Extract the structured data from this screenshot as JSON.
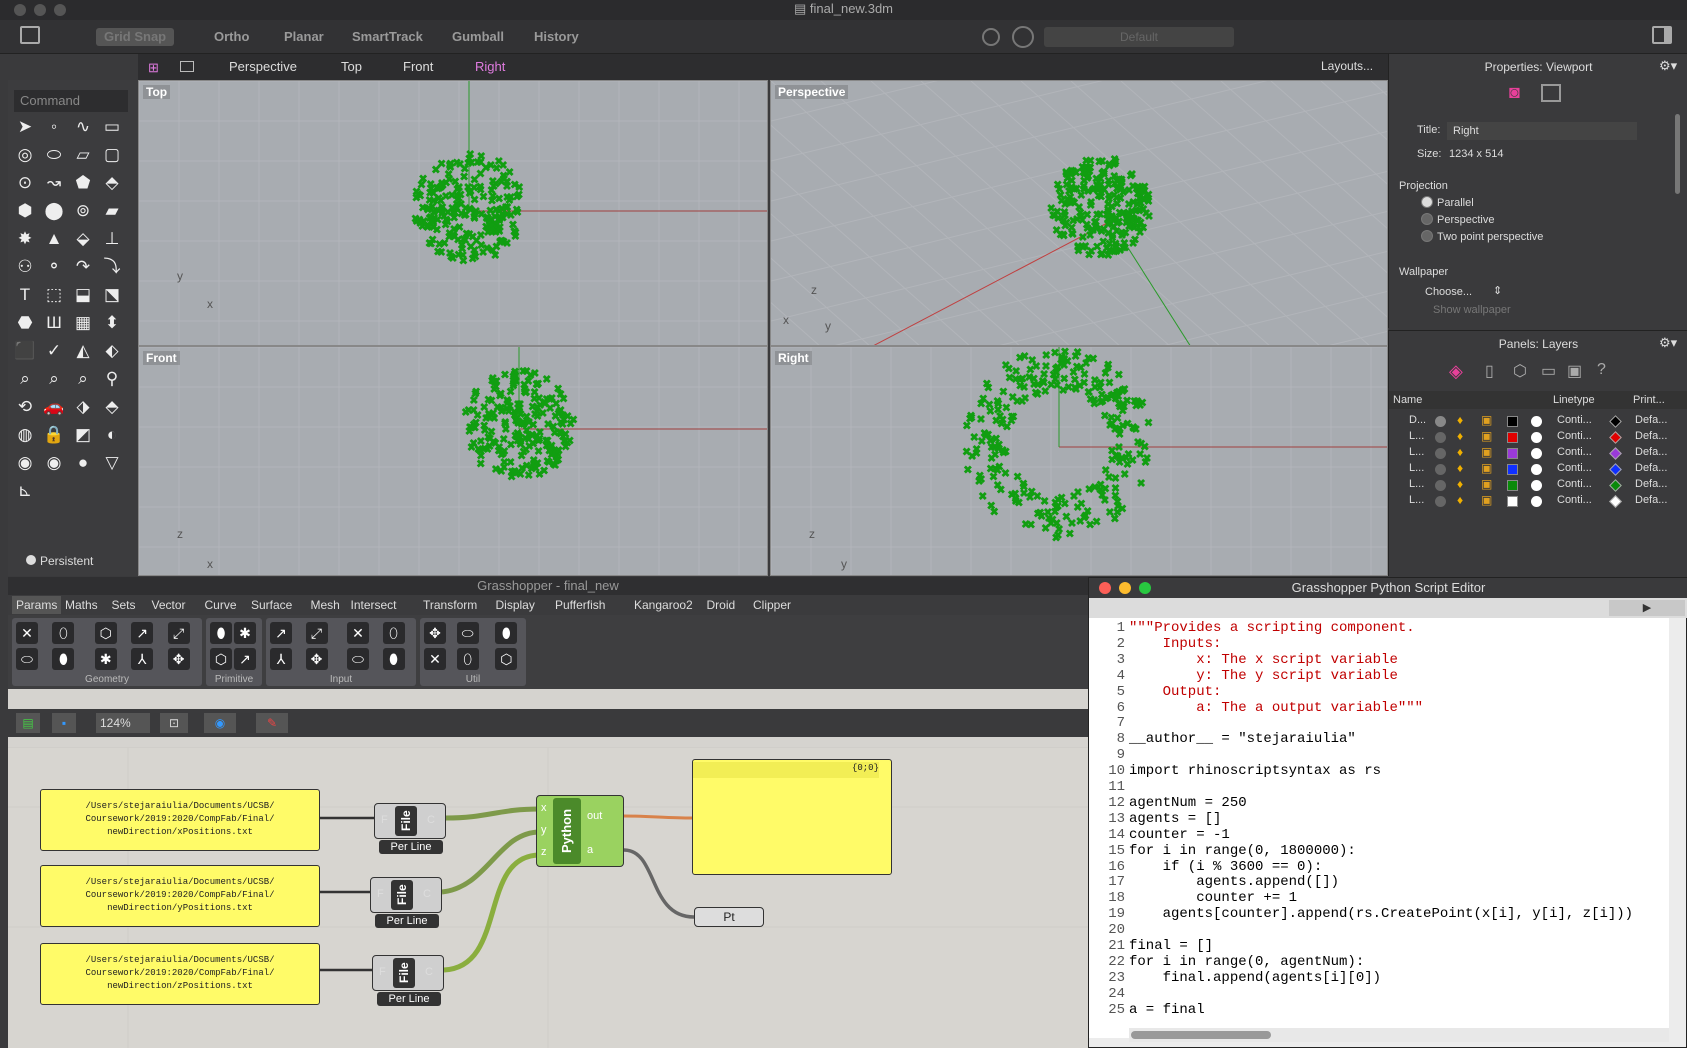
{
  "window": {
    "title": "final_new.3dm"
  },
  "main_toolbar": {
    "buttons": [
      "Grid Snap",
      "Ortho",
      "Planar",
      "SmartTrack",
      "Gumball",
      "History"
    ],
    "layer_box": "Default"
  },
  "viewport_tabs": {
    "tabs": [
      "Perspective",
      "Top",
      "Front",
      "Right"
    ],
    "active": "Right",
    "layouts": "Layouts..."
  },
  "command": {
    "placeholder": "Command",
    "osnap": "Persistent"
  },
  "viewports": {
    "top": {
      "label": "Top",
      "axis_a": "y",
      "axis_b": "x"
    },
    "perspective": {
      "label": "Perspective",
      "axis_a": "z",
      "axis_b": "x",
      "axis_c": "y"
    },
    "front": {
      "label": "Front",
      "axis_a": "z",
      "axis_b": "x"
    },
    "right": {
      "label": "Right",
      "axis_a": "z",
      "axis_b": "y"
    }
  },
  "properties": {
    "header": "Properties: Viewport",
    "title_label": "Title:",
    "title_value": "Right",
    "size_label": "Size:",
    "size_value": "1234 x 514",
    "projection_label": "Projection",
    "projection_options": [
      "Parallel",
      "Perspective",
      "Two point perspective"
    ],
    "projection_selected": "Parallel",
    "wallpaper_label": "Wallpaper",
    "wallpaper_choose": "Choose...",
    "show_wallpaper": "Show wallpaper"
  },
  "layers": {
    "header": "Panels: Layers",
    "columns": [
      "Name",
      "Linetype",
      "Print..."
    ],
    "rows": [
      {
        "name": "D...",
        "color": "#000000",
        "linetype": "Conti...",
        "print": "Defa..."
      },
      {
        "name": "L...",
        "color": "#e00000",
        "linetype": "Conti...",
        "print": "Defa..."
      },
      {
        "name": "L...",
        "color": "#9a3ad8",
        "linetype": "Conti...",
        "print": "Defa..."
      },
      {
        "name": "L...",
        "color": "#1030ff",
        "linetype": "Conti...",
        "print": "Defa..."
      },
      {
        "name": "L...",
        "color": "#0a8a0a",
        "linetype": "Conti...",
        "print": "Defa..."
      },
      {
        "name": "L...",
        "color": "#ffffff",
        "linetype": "Conti...",
        "print": "Defa..."
      }
    ]
  },
  "grasshopper": {
    "title": "Grasshopper - final_new",
    "tabs": [
      "Params",
      "Maths",
      "Sets",
      "Vector",
      "Curve",
      "Surface",
      "Mesh",
      "Intersect",
      "Transform",
      "Display",
      "Pufferfish",
      "Kangaroo2",
      "Droid",
      "Clipper"
    ],
    "palette_groups": [
      "Geometry",
      "Primitive",
      "Input",
      "Util"
    ],
    "zoom": "124%",
    "panels": [
      "/Users/stejaraiulia/Documents/UCSB/ Coursework/2019:2020/CompFab/Final/ newDirection/xPositions.txt",
      "/Users/stejaraiulia/Documents/UCSB/ Coursework/2019:2020/CompFab/Final/ newDirection/yPositions.txt",
      "/Users/stejaraiulia/Documents/UCSB/ Coursework/2019:2020/CompFab/Final/ newDirection/zPositions.txt"
    ],
    "file_component": {
      "left": "F",
      "name": "File",
      "right": "C",
      "label": "Per Line"
    },
    "python": {
      "name": "Python",
      "inputs": [
        "x",
        "y",
        "z"
      ],
      "outputs": [
        "out",
        "a"
      ]
    },
    "output_panel_header": "{0;0}",
    "pt_label": "Pt"
  },
  "editor": {
    "title": "Grasshopper Python Script Editor",
    "run": "▶",
    "lines": [
      "\"\"\"Provides a scripting component.",
      "    Inputs:",
      "        x: The x script variable",
      "        y: The y script variable",
      "    Output:",
      "        a: The a output variable\"\"\"",
      "",
      "__author__ = \"stejaraiulia\"",
      "",
      "import rhinoscriptsyntax as rs",
      "",
      "agentNum = 250",
      "agents = []",
      "counter = -1",
      "for i in range(0, 1800000):",
      "    if (i % 3600 == 0):",
      "        agents.append([])",
      "        counter += 1",
      "    agents[counter].append(rs.CreatePoint(x[i], y[i], z[i]))",
      "",
      "final = []",
      "for i in range(0, agentNum):",
      "    final.append(agents[i][0])",
      "",
      "a = final"
    ]
  },
  "colors": {
    "point_green": "#119e11",
    "panel_yellow": "#fffb68",
    "active_tab": "#e07be0"
  }
}
